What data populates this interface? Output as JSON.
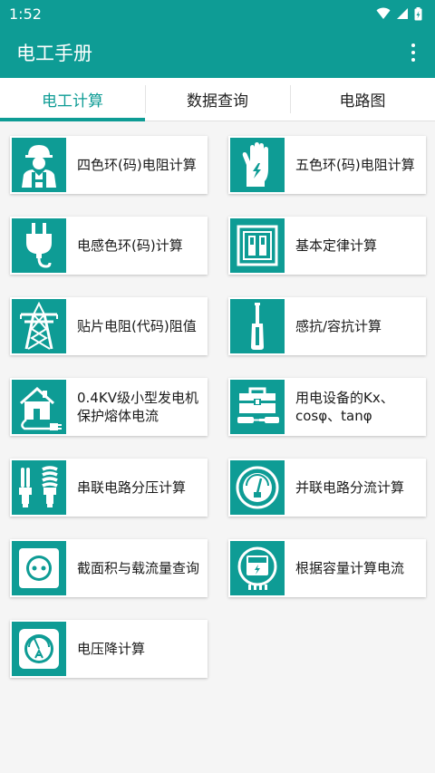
{
  "status": {
    "time": "1:52"
  },
  "app": {
    "title": "电工手册"
  },
  "tabs": [
    {
      "label": "电工计算"
    },
    {
      "label": "数据查询"
    },
    {
      "label": "电路图"
    }
  ],
  "cards": [
    {
      "label": "四色环(码)电阻计算",
      "icon": "worker-icon"
    },
    {
      "label": "五色环(码)电阻计算",
      "icon": "insulated-glove-icon"
    },
    {
      "label": "电感色环(码)计算",
      "icon": "plug-icon"
    },
    {
      "label": "基本定律计算",
      "icon": "switch-panel-icon"
    },
    {
      "label": "贴片电阻(代码)阻值",
      "icon": "power-tower-icon"
    },
    {
      "label": "感抗/容抗计算",
      "icon": "screwdriver-icon"
    },
    {
      "label": "0.4KV级小型发电机保护熔体电流",
      "icon": "house-plug-icon"
    },
    {
      "label": "用电设备的Kx、cosφ、tanφ",
      "icon": "toolbox-icon"
    },
    {
      "label": "串联电路分压计算",
      "icon": "bulbs-icon"
    },
    {
      "label": "并联电路分流计算",
      "icon": "meter-dial-icon"
    },
    {
      "label": "截面积与载流量查询",
      "icon": "socket-icon"
    },
    {
      "label": "根据容量计算电流",
      "icon": "electric-meter-icon"
    },
    {
      "label": "电压降计算",
      "icon": "ammeter-icon"
    }
  ],
  "colors": {
    "primary": "#0e9c95"
  }
}
